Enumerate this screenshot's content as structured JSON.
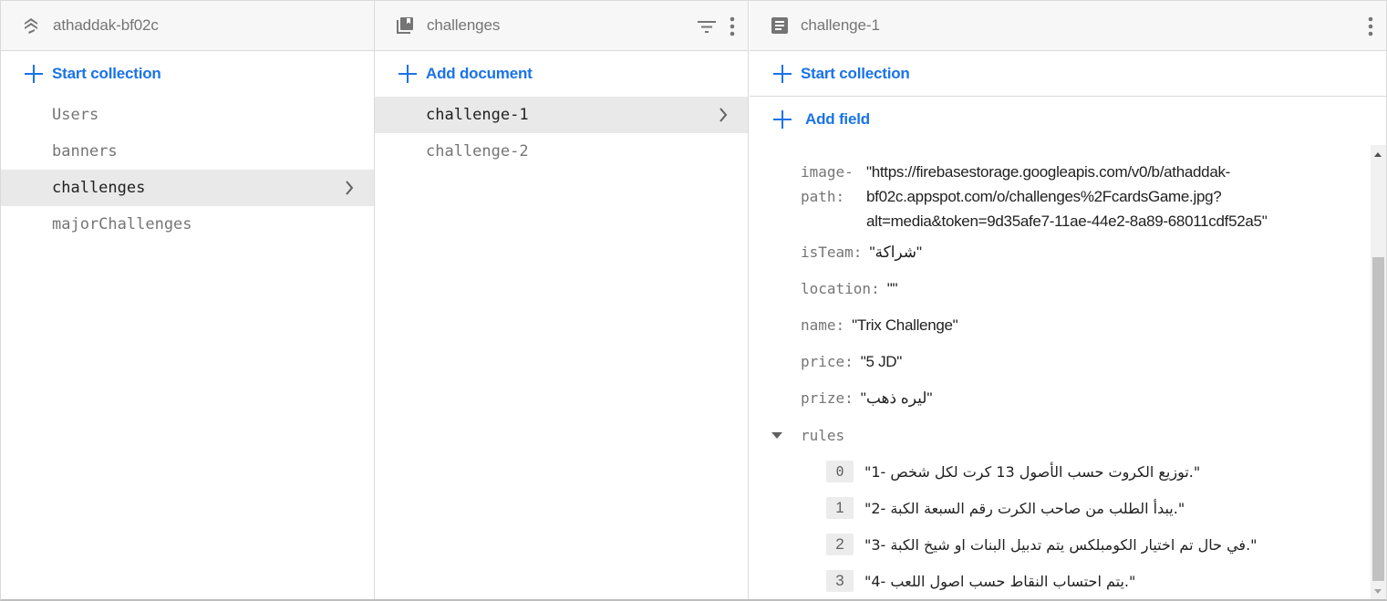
{
  "colors": {
    "accent": "#1a73e8",
    "header_bg": "#f7f7f7",
    "selected_bg": "#e9e9e9",
    "muted_text": "#757575"
  },
  "root_panel": {
    "title": "athaddak-bf02c",
    "icon": "firestore-stack-icon",
    "action_label": "Start collection",
    "collections": [
      {
        "label": "Users",
        "selected": false
      },
      {
        "label": "banners",
        "selected": false
      },
      {
        "label": "challenges",
        "selected": true
      },
      {
        "label": "majorChallenges",
        "selected": false
      }
    ]
  },
  "collection_panel": {
    "title": "challenges",
    "icon": "collection-icon",
    "filter_icon": "filter-icon",
    "more_icon": "more-vert-icon",
    "action_label": "Add document",
    "documents": [
      {
        "label": "challenge-1",
        "selected": true
      },
      {
        "label": "challenge-2",
        "selected": false
      }
    ]
  },
  "document_panel": {
    "title": "challenge-1",
    "icon": "document-icon",
    "more_icon": "more-vert-icon",
    "start_collection_label": "Start collection",
    "add_field_label": "Add field",
    "fields": {
      "image_path": {
        "key_line1": "image-",
        "key_line2": "path:",
        "value_line1": "\"https://firebasestorage.googleapis.com/v0/b/athaddak-",
        "value_line2": "bf02c.appspot.com/o/challenges%2FcardsGame.jpg?",
        "value_line3": "alt=media&token=9d35afe7-11ae-44e2-8a89-68011cdf52a5\""
      },
      "isTeam": {
        "key": "isTeam:",
        "value": "\"شراكة\""
      },
      "location": {
        "key": "location:",
        "value": "\"\""
      },
      "name": {
        "key": "name:",
        "value": "\"Trix Challenge\""
      },
      "price": {
        "key": "price:",
        "value": "\"5 JD\""
      },
      "prize": {
        "key": "prize:",
        "value": "\"ليره ذهب\""
      },
      "rules": {
        "key": "rules",
        "expanded": true,
        "items": [
          {
            "index": "0",
            "value": "\"1- توزيع الكروت حسب الأصول 13 كرت لكل شخص.\""
          },
          {
            "index": "1",
            "value": "\"2- يبدأ الطلب من صاحب الكرت رقم السبعة الكبة.\""
          },
          {
            "index": "2",
            "value": "\"3- في حال تم اختيار الكومبلكس يتم تدبيل البنات او شيخ الكبة.\""
          },
          {
            "index": "3",
            "value": "\"4- يتم احتساب النقاط حسب اصول اللعب.\""
          }
        ]
      }
    },
    "scroll_position_fraction": 0.25
  }
}
